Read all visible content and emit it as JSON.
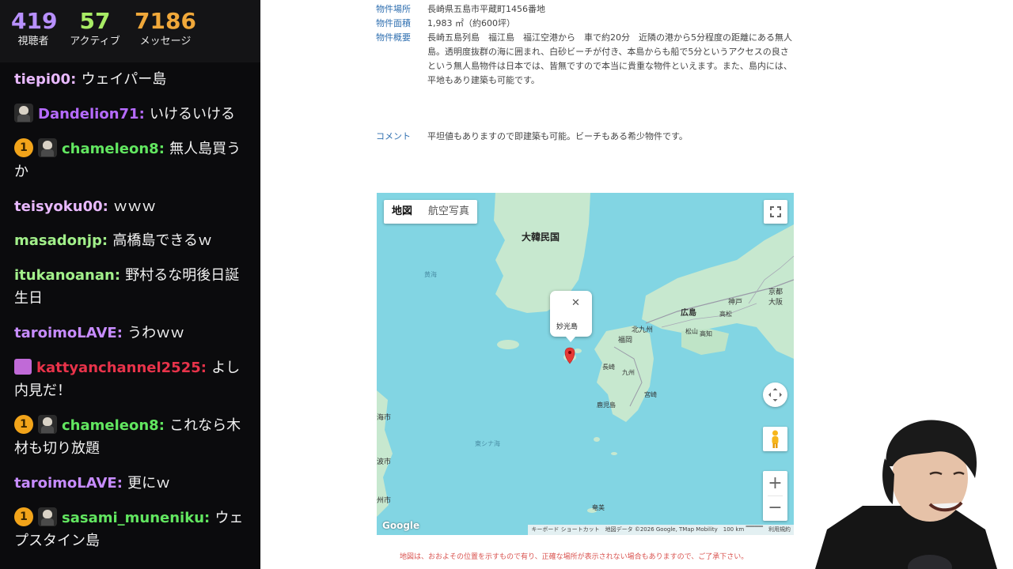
{
  "stats": {
    "viewers": {
      "value": "419",
      "label": "視聴者",
      "color": "#b890ff"
    },
    "active": {
      "value": "57",
      "label": "アクティブ",
      "color": "#a8ec65"
    },
    "messages": {
      "value": "7186",
      "label": "メッセージ",
      "color": "#f0a83a"
    }
  },
  "chat": [
    {
      "user": "tiepi00",
      "text": "ウェイパー島",
      "color": "#e9b9ff",
      "badges": []
    },
    {
      "user": "Dandelion71",
      "text": "いけるいける",
      "color": "#b66bff",
      "badges": [
        "avatar"
      ]
    },
    {
      "user": "chameleon8",
      "text": "無人島買うか",
      "color": "#62e660",
      "badges": [
        "one",
        "avatar"
      ]
    },
    {
      "user": "teisyoku00",
      "text": "ｗｗｗ",
      "color": "#e9b9ff",
      "badges": []
    },
    {
      "user": "masadonjp",
      "text": "高橋島できるｗ",
      "color": "#a2f08a",
      "badges": []
    },
    {
      "user": "itukanoanan",
      "text": "野村るな明後日誕生日",
      "color": "#a2f08a",
      "badges": []
    },
    {
      "user": "taroimoLAVE",
      "text": "うわｗｗ",
      "color": "#c78cff",
      "badges": []
    },
    {
      "user": "kattyanchannel2525",
      "text": "よし内見だ！",
      "color": "#e8334a",
      "badges": [
        "gift"
      ]
    },
    {
      "user": "chameleon8",
      "text": "これなら木材も切り放題",
      "color": "#62e660",
      "badges": [
        "one",
        "avatar"
      ]
    },
    {
      "user": "taroimoLAVE",
      "text": "更にｗ",
      "color": "#c78cff",
      "badges": []
    },
    {
      "user": "sasami_muneniku",
      "text": "ウェプスタイン島",
      "color": "#62e660",
      "badges": [
        "one",
        "avatar"
      ]
    }
  ],
  "badge_one_text": "1",
  "property": {
    "location": {
      "key": "物件場所",
      "value": "長崎県五島市平蔵町1456番地"
    },
    "area": {
      "key": "物件面積",
      "value": "1,983 ㎡（約600坪）"
    },
    "overview": {
      "key": "物件概要",
      "value": "長崎五島列島　福江島　福江空港から　車で約20分　近隣の港から5分程度の距離にある無人島。透明度抜群の海に囲まれ、白砂ビーチが付き、本島からも船で5分というアクセスの良さという無人島物件は日本では、皆無ですので本当に貴重な物件といえます。また、島内には、平地もあり建築も可能です。"
    },
    "comment": {
      "key": "コメント",
      "value": "平坦値もありますので即建築も可能。ビーチもある希少物件です。"
    }
  },
  "map": {
    "tab_map": "地図",
    "tab_satellite": "航空写真",
    "popup_label": "妙光島",
    "close_glyph": "✕",
    "zoom_in": "+",
    "zoom_out": "−",
    "logo": "Google",
    "attribution": "キーボード ショートカット　地図データ ©2026 Google, TMap Mobility　100 km ▔▔▔▔　利用規約",
    "labels": {
      "korea": "大韓民国",
      "hiroshima": "広島",
      "kobe": "神戸",
      "osaka": "大阪",
      "kyoto": "京都",
      "kitakyushu": "北九州",
      "fukuoka": "福岡",
      "matsuyama": "松山",
      "kochi": "高知",
      "nagasaki": "長崎",
      "kyushu": "九州",
      "miyazaki": "宮崎",
      "kagoshima": "鹿児島",
      "amami": "奄美",
      "yellow_sea": "黄海",
      "east_china_sea": "東シナ海",
      "edge1": "海市",
      "edge2": "波市",
      "edge3": "州市",
      "edge4": "高松",
      "edge5": "大戸"
    },
    "colors": {
      "sea": "#82d5e3",
      "land": "#c7e8cf",
      "road": "#9a9aa8",
      "pin": "#e53935"
    }
  },
  "disclaimer": "地図は、おおよその位置を示すもので有り、正確な場所が表示されない場合もありますので、ご了承下さい。"
}
